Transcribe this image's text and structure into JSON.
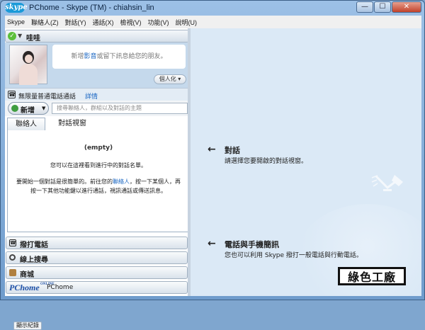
{
  "window": {
    "logo_text": "skype",
    "title": "PChome - Skype (TM) - chiahsin_lin",
    "buttons": {
      "minimize": "—",
      "maximize": "☐",
      "close": "✕"
    }
  },
  "menu": [
    "Skype",
    "聯絡人(Z)",
    "對話(Y)",
    "通話(X)",
    "檢視(V)",
    "功能(V)",
    "說明(U)"
  ],
  "profile": {
    "name": "哇哇",
    "mood_before": "新增",
    "mood_link": "影音",
    "mood_after": "或留下訊息給您的朋友。",
    "personalize": "個人化"
  },
  "callbar": {
    "text": "無限量普通電話通話",
    "link": "詳情"
  },
  "add": {
    "label": "新增",
    "search_placeholder": "搜尋聯絡人，群組以及對話的主題"
  },
  "tabs": {
    "contacts": "聯絡人",
    "conversations": "對話視窗"
  },
  "listpane": {
    "empty": "(empty)",
    "line1": "您可以在這裡看到進行中的對話名單。",
    "line2_before": "要開始一個對話是很簡單的。前往您的",
    "line2_link": "聯絡人",
    "line2_after": "，按一下某個人，再按一下其他功能鍵以進行通話，視訊通話或傳送訊息。",
    "show_log": "顯示紀錄"
  },
  "bottom_bars": {
    "call_phones": "撥打電話",
    "online_search": "線上搜尋",
    "shop": "商城",
    "pchome_logo": "PChome",
    "pchome_small": "ONLINE",
    "pchome_label": "PChome"
  },
  "right": {
    "section1_title": "對話",
    "section1_desc": "請選擇您要開啟的對話視窗。",
    "section2_title": "電話與手機簡訊",
    "section2_desc": "您也可以利用 Skype 撥打一般電話與行動電話。",
    "stamp": "綠色工廠"
  },
  "colors": {
    "accent": "#1a66c2",
    "online": "#5bbf3a",
    "frame": "#7fa6cf"
  }
}
